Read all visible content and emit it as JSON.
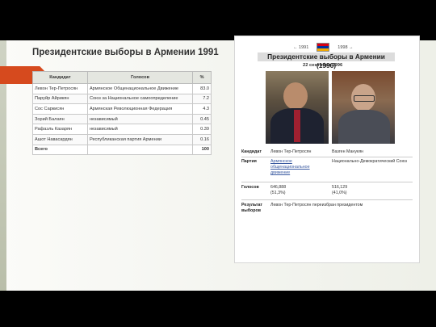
{
  "title": "Президентские выборы в Армении 1991",
  "table": {
    "headers": [
      "Кандидат",
      "Голосов",
      "%"
    ],
    "rows": [
      {
        "candidate": "Левон Тер-Петросян",
        "party": "Армянское Общенациональное Движение",
        "pct": "83.0"
      },
      {
        "candidate": "Паруйр Айрикян",
        "party": "Союз за Национальное самоопределение",
        "pct": "7.2"
      },
      {
        "candidate": "Сос Саркисян",
        "party": "Армянская Революционная Федерация",
        "pct": "4.3"
      },
      {
        "candidate": "Зорий Балаян",
        "party": "независимый",
        "pct": "0.45"
      },
      {
        "candidate": "Рафаэль Казарян",
        "party": "независимый",
        "pct": "0.39"
      },
      {
        "candidate": "Ашот Навасардян",
        "party": "Республиканская партия Армении",
        "pct": "0.16"
      }
    ],
    "total_label": "Всего",
    "total_value": "100"
  },
  "infobox": {
    "prev_year": "← 1991",
    "next_year": "1998 →",
    "title": "Президентские выборы в Армении (1996)",
    "date": "22 сентября 1996",
    "candidate_label": "Кандидат",
    "candidate_1": "Левон Тер-Петросян",
    "candidate_2": "Вазген Манукян",
    "party_label": "Партия",
    "party_1": "Армянское общенациональное движение",
    "party_2": "Национально-Демократический Союз",
    "votes_label": "Голосов",
    "votes_1": "646,888",
    "votes_1_pct": "(51,3%)",
    "votes_2": "516,129",
    "votes_2_pct": "(41,0%)",
    "result_label": "Результат выборов",
    "result_text": "Левон Тер-Петросян переизбран президентом",
    "flag_colors": [
      "#d90012",
      "#0033a0",
      "#f2a800"
    ]
  }
}
